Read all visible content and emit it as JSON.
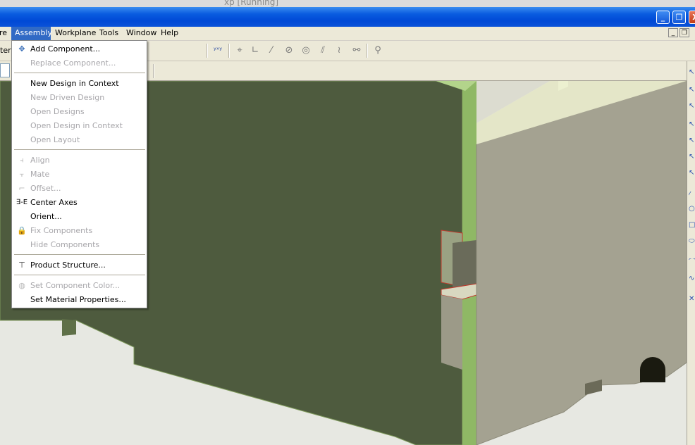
{
  "host": {
    "title": "xp [Running]"
  },
  "window": {
    "buttons": {
      "minimize": "_",
      "restore": "❐",
      "close": "X"
    },
    "mdi_buttons": {
      "minimize": "_",
      "restore": "❐"
    }
  },
  "menubar": {
    "items": [
      {
        "label": "re"
      },
      {
        "label": "Assembly"
      },
      {
        "label": "Workplane"
      },
      {
        "label": "Tools"
      },
      {
        "label": "Window"
      },
      {
        "label": "Help"
      }
    ]
  },
  "toolbar": {
    "clipped_label": "ter /"
  },
  "assembly_menu": {
    "items": [
      {
        "label": "Add Component...",
        "icon": "add-component-icon"
      },
      {
        "label": "Replace Component..."
      },
      {
        "label": "New Design in Context"
      },
      {
        "label": "New Driven Design"
      },
      {
        "label": "Open Designs"
      },
      {
        "label": "Open Design in Context"
      },
      {
        "label": "Open Layout"
      },
      {
        "label": "Align",
        "icon": "align-icon"
      },
      {
        "label": "Mate",
        "icon": "mate-icon"
      },
      {
        "label": "Offset...",
        "icon": "offset-icon"
      },
      {
        "label": "Center Axes",
        "icon": "center-axes-icon",
        "glyph": "∃-E"
      },
      {
        "label": "Orient..."
      },
      {
        "label": "Fix Components",
        "icon": "fix-components-icon"
      },
      {
        "label": "Hide Components"
      },
      {
        "label": "Product Structure...",
        "icon": "product-structure-icon"
      },
      {
        "label": "Set Component Color...",
        "icon": "component-color-icon"
      },
      {
        "label": "Set Material Properties..."
      }
    ]
  },
  "colors": {
    "selection": "#316ac5",
    "menu_bg": "#ece9d8",
    "part_green": "#4e5b3e",
    "part_gray": "#a4a291",
    "edge_green": "#8fb865",
    "viewport_bg": "#e9eae4"
  }
}
